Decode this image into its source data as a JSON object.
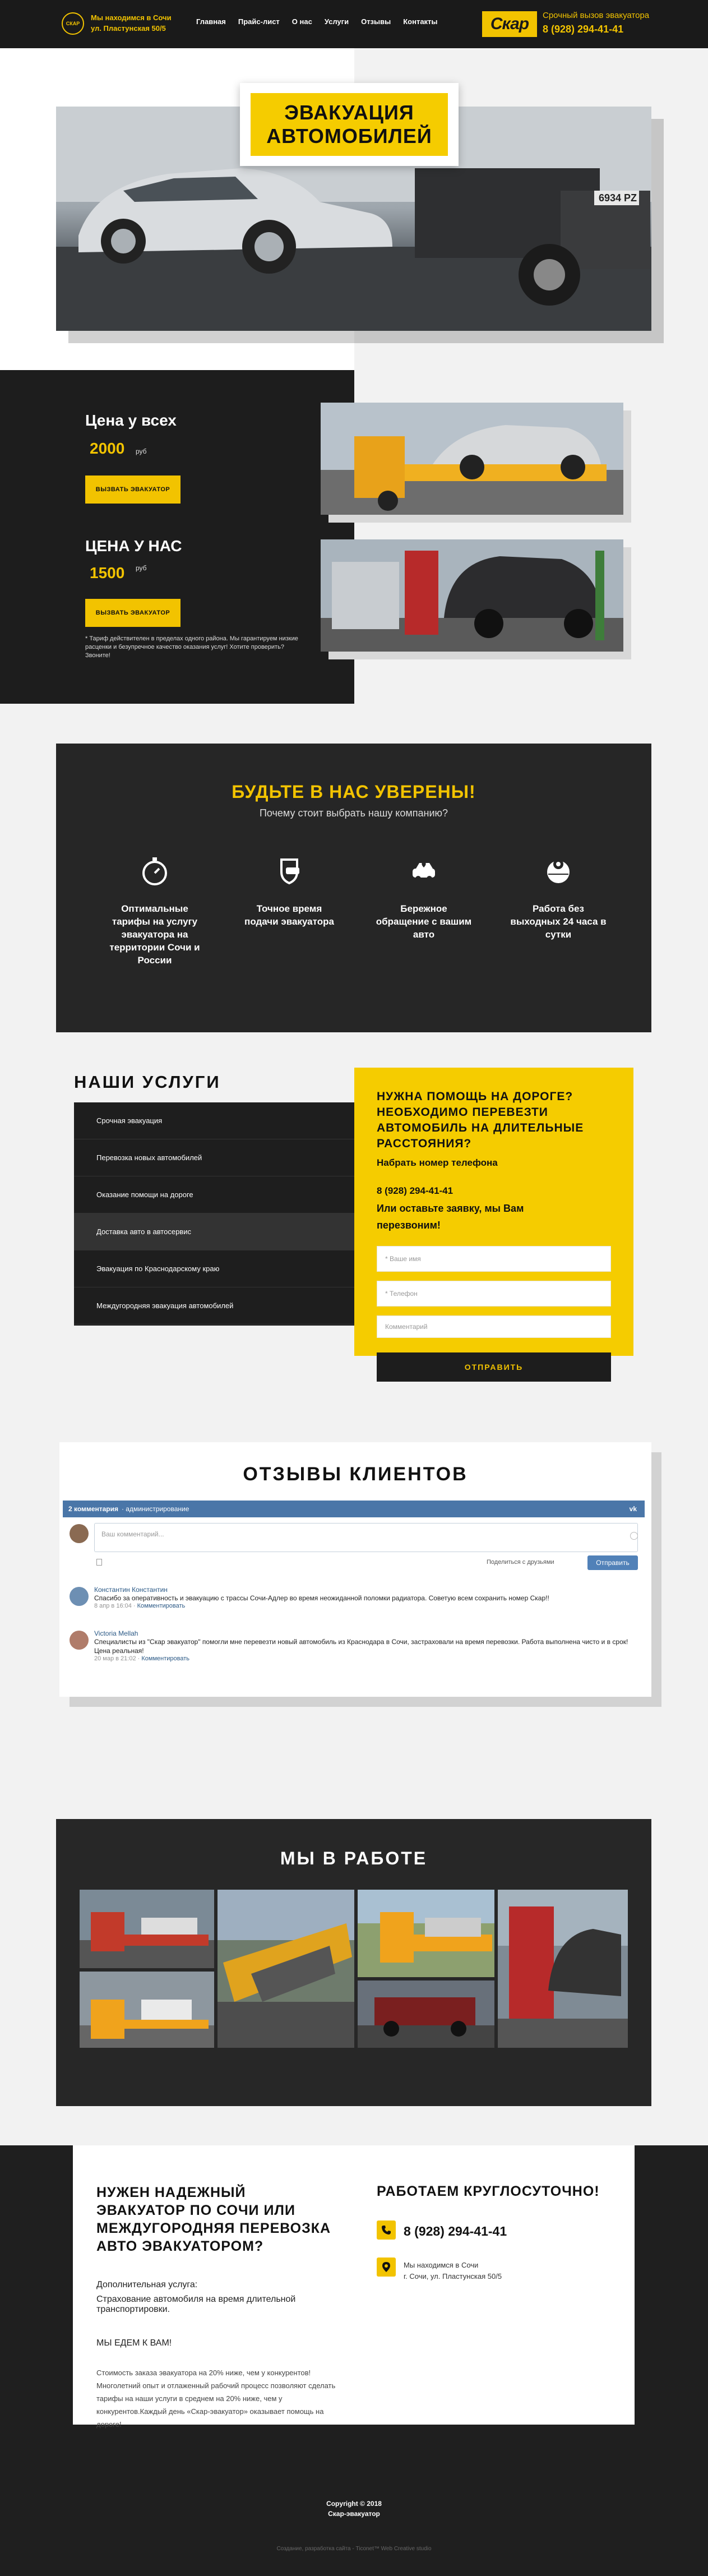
{
  "header": {
    "location_line1": "Мы находимся в Сочи",
    "location_line2": "ул. Пластунская 50/5",
    "logo_text": "СКАР",
    "nav": [
      "Главная",
      "Прайс-лист",
      "О нас",
      "Услуги",
      "Отзывы",
      "Контакты"
    ],
    "brand": "Скар",
    "call_label": "Срочный вызов эвакуатора",
    "phone": "8 (928) 294-41-41"
  },
  "hero": {
    "title_line1": "ЭВАКУАЦИЯ",
    "title_line2": "АВТОМОБИЛЕЙ",
    "plate": "6934 PZ"
  },
  "prices": {
    "everyone_label": "Цена у всех",
    "everyone_value": "2000",
    "ours_label": "ЦЕНА У НАС",
    "ours_value": "1500",
    "currency": "руб",
    "button_label": "ВЫЗВАТЬ ЭВАКУАТОР",
    "note": "* Тариф действителен в пределах одного района. Мы гарантируем низкие расценки и безупречное качество оказания услуг! Хотите проверить? Звоните!"
  },
  "trust": {
    "title": "БУДЬТЕ В НАС УВЕРЕНЫ!",
    "subtitle": "Почему стоит выбрать нашу компанию?",
    "features": [
      {
        "icon": "stopwatch-icon",
        "text": "Оптимальные тарифы на услугу эвакуатора на территории Сочи и России"
      },
      {
        "icon": "shield-car-icon",
        "text": "Точное время подачи эвакуатора"
      },
      {
        "icon": "car-heart-icon",
        "text": "Бережное обращение с вашим авто"
      },
      {
        "icon": "globe-pin-icon",
        "text": "Работа без выходных 24 часа в сутки"
      }
    ]
  },
  "services": {
    "title": "НАШИ УСЛУГИ",
    "items": [
      "Срочная эвакуация",
      "Перевозка новых автомобилей",
      "Оказание помощи на дороге",
      "Доставка авто в автосервис",
      "Эвакуация по Краснодарскому краю",
      "Междугородняя эвакуация автомобилей"
    ]
  },
  "help": {
    "title": "НУЖНА ПОМОЩЬ НА ДОРОГЕ? НЕОБХОДИМО ПЕРЕВЕЗТИ АВТОМОБИЛЬ НА ДЛИТЕЛЬНЫЕ РАССТОЯНИЯ?",
    "phone_label": "Набрать номер телефона",
    "phone": "8 (928) 294-41-41",
    "ask": "Или оставьте заявку, мы Вам перезвоним!",
    "name_placeholder": "* Ваше имя",
    "phone_placeholder": "* Телефон",
    "comment_placeholder": "Комментарий",
    "submit": "ОТПРАВИТЬ"
  },
  "reviews": {
    "title": "ОТЗЫВЫ КЛИЕНТОВ",
    "widget": {
      "count": "2 комментария",
      "admin": "· администрирование",
      "vk": "vk",
      "placeholder": "Ваш комментарий...",
      "share": "Поделиться с друзьями",
      "send": "Отправить",
      "comments": [
        {
          "name": "Константин Константин",
          "text": "Спасибо за оперативность и эвакуацию с трассы Сочи-Адлер во время неожиданной поломки радиатора. Советую всем сохранить номер Скар!!",
          "date": "8 апр в 16:04",
          "action": "Комментировать"
        },
        {
          "name": "Victoria Mellah",
          "text": "Специалисты из \"Скар эвакуатор\" помогли мне перевезти новый автомобиль из Краснодара в Сочи, застраховали на время перевозки. Работа выполнена чисто и в срок! Цена реальная!",
          "date": "20 мар в 21:02",
          "action": "Комментировать"
        }
      ]
    }
  },
  "works": {
    "title": "МЫ В РАБОТЕ"
  },
  "bottom": {
    "title": "НУЖЕН НАДЕЖНЫЙ ЭВАКУАТОР ПО СОЧИ ИЛИ МЕЖДУГОРОДНЯЯ ПЕРЕВОЗКА АВТО ЭВАКУАТОРОМ?",
    "extra_label": "Дополнительная услуга:",
    "extra_text": "Страхование автомобиля на время длительной транспортировки.",
    "go": "МЫ ЕДЕМ К ВАМ!",
    "small": "Стоимость заказа эвакуатора на 20% ниже, чем у конкурентов! Многолетний опыт и отлаженный рабочий процесс позволяют сделать тарифы на наши услуги в среднем на 20% ниже, чем у конкурентов.Каждый день «Скар-эвакуатор» оказывает помощь на дороге!",
    "hours_title": "РАБОТАЕМ КРУГЛОСУТОЧНО!",
    "phone": "8 (928) 294-41-41",
    "addr_line1": "Мы находимся в Сочи",
    "addr_line2": "г. Сочи, ул. Пластунская 50/5"
  },
  "footer": {
    "copyright": "Copyright © 2018",
    "company": "Скар-эвакуатор",
    "credit": "Создание, разработка сайта - Ticonet™ Web Creative studio"
  },
  "colors": {
    "accent": "#f2c300",
    "dark": "#1d1d1d",
    "vk": "#4a76a8"
  }
}
